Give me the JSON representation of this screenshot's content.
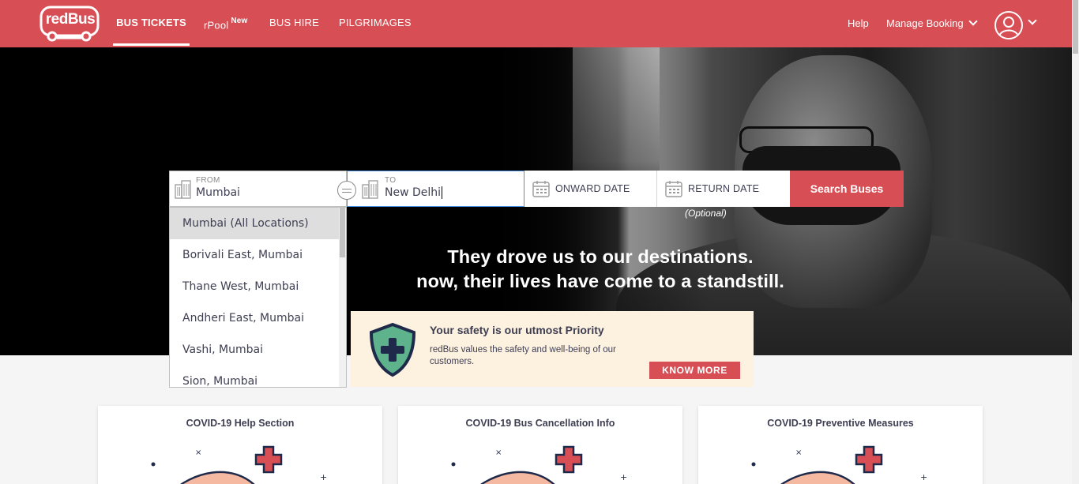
{
  "brand": {
    "logo_text": "redBus",
    "color": "#d84e55"
  },
  "nav": {
    "bus_tickets": "BUS TICKETS",
    "rpool": "rPool",
    "rpool_badge": "New",
    "bus_hire": "BUS HIRE",
    "pilgrimages": "PILGRIMAGES"
  },
  "header_right": {
    "help": "Help",
    "manage_booking": "Manage Booking"
  },
  "search": {
    "from_label": "FROM",
    "from_value": "Mumbai",
    "to_label": "TO",
    "to_value": "New Delhi",
    "onward_label": "ONWARD DATE",
    "return_label": "RETURN DATE",
    "return_hint": "(Optional)",
    "button": "Search Buses"
  },
  "dropdown": {
    "items": [
      "Mumbai (All Locations)",
      "Borivali East, Mumbai",
      "Thane West, Mumbai",
      "Andheri East, Mumbai",
      "Vashi, Mumbai",
      "Sion, Mumbai"
    ]
  },
  "hero": {
    "line1": "They drove us to our destinations.",
    "line2": "now, their lives have come to a standstill."
  },
  "safety": {
    "title": "Your safety is our utmost Priority",
    "text": "redBus values the safety and well-being of our customers.",
    "button": "KNOW MORE"
  },
  "cards": [
    {
      "title": "COVID-19 Help Section"
    },
    {
      "title": "COVID-19 Bus Cancellation Info"
    },
    {
      "title": "COVID-19 Preventive Measures"
    }
  ],
  "icons": [
    "redbus-logo-icon",
    "chevron-down-icon",
    "user-avatar-icon",
    "building-icon",
    "swap-icon",
    "calendar-icon",
    "shield-plus-icon"
  ]
}
